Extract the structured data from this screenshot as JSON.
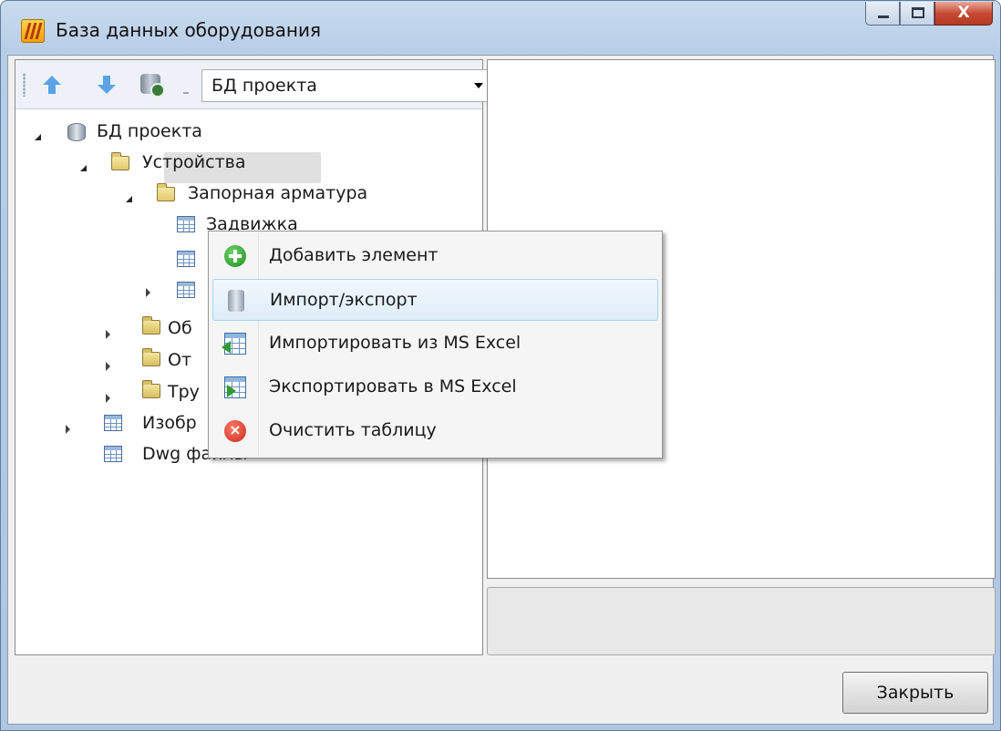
{
  "window": {
    "title": "База данных оборудования",
    "close_glyph": "X",
    "accent_color": "#c84a34"
  },
  "toolbar": {
    "db_select_value": "БД проекта",
    "icons": [
      "move-up-icon",
      "move-down-icon",
      "database-settings-icon"
    ]
  },
  "tree": {
    "root": "БД проекта",
    "devices": "Устройства",
    "shutoff_valves": "Запорная арматура",
    "gate_valve": "Задвижка",
    "equipment_partial": "Об",
    "other_partial": "От",
    "pipes_partial": "Тру",
    "images_partial": "Изобр",
    "dwg_files": "Dwg файлы"
  },
  "context_menu": {
    "items": [
      {
        "label": "Добавить элемент",
        "icon": "add-icon"
      },
      {
        "label": "Импорт/экспорт",
        "icon": "database-icon"
      },
      {
        "label": "Импортировать из MS Excel",
        "icon": "import-excel-icon"
      },
      {
        "label": "Экспортировать в MS Excel",
        "icon": "export-excel-icon"
      },
      {
        "label": "Очистить таблицу",
        "icon": "clear-icon"
      }
    ]
  },
  "footer": {
    "close_button": "Закрыть"
  }
}
